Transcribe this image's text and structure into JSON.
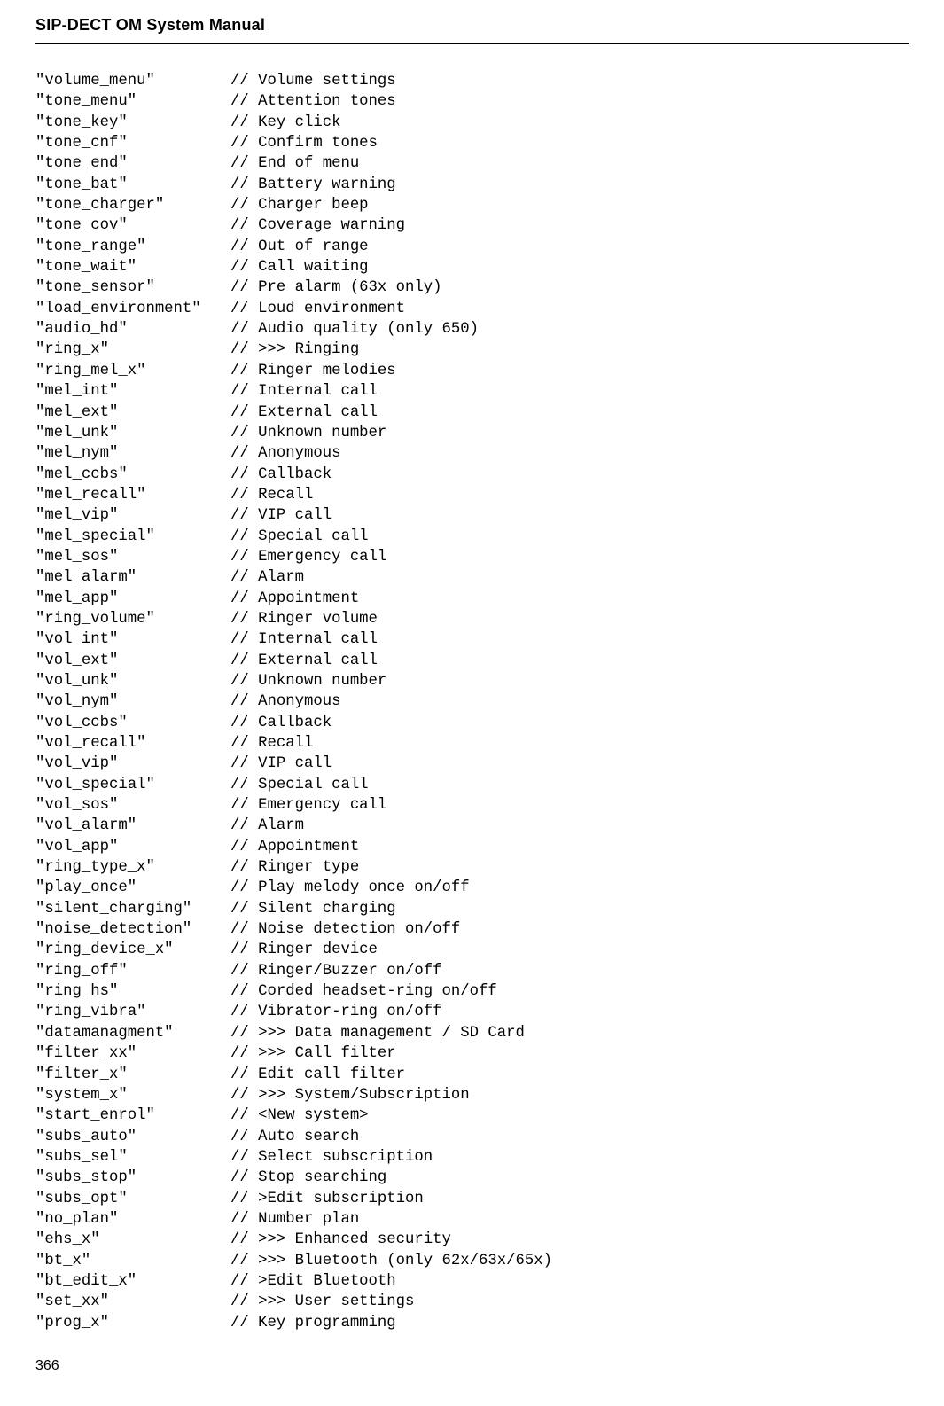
{
  "header": {
    "title": "SIP-DECT OM System Manual"
  },
  "page_number": "366",
  "code_rows": [
    {
      "key": "\"volume_menu\"",
      "comment": "// Volume settings"
    },
    {
      "key": "\"tone_menu\"",
      "comment": "// Attention tones"
    },
    {
      "key": "\"tone_key\"",
      "comment": "// Key click"
    },
    {
      "key": "\"tone_cnf\"",
      "comment": "// Confirm tones"
    },
    {
      "key": "\"tone_end\"",
      "comment": "// End of menu"
    },
    {
      "key": "\"tone_bat\"",
      "comment": "// Battery warning"
    },
    {
      "key": "\"tone_charger\"",
      "comment": "// Charger beep"
    },
    {
      "key": "\"tone_cov\"",
      "comment": "// Coverage warning"
    },
    {
      "key": "\"tone_range\"",
      "comment": "// Out of range"
    },
    {
      "key": "\"tone_wait\"",
      "comment": "// Call waiting"
    },
    {
      "key": "\"tone_sensor\"",
      "comment": "// Pre alarm (63x only)"
    },
    {
      "key": "\"load_environment\"",
      "comment": "// Loud environment"
    },
    {
      "key": "\"audio_hd\"",
      "comment": "// Audio quality (only 650)"
    },
    {
      "key": "\"ring_x\"",
      "comment": "// >>> Ringing"
    },
    {
      "key": "\"ring_mel_x\"",
      "comment": "// Ringer melodies"
    },
    {
      "key": "\"mel_int\"",
      "comment": "// Internal call"
    },
    {
      "key": "\"mel_ext\"",
      "comment": "// External call"
    },
    {
      "key": "\"mel_unk\"",
      "comment": "// Unknown number"
    },
    {
      "key": "\"mel_nym\"",
      "comment": "// Anonymous"
    },
    {
      "key": "\"mel_ccbs\"",
      "comment": "// Callback"
    },
    {
      "key": "\"mel_recall\"",
      "comment": "// Recall"
    },
    {
      "key": "\"mel_vip\"",
      "comment": "// VIP call"
    },
    {
      "key": "\"mel_special\"",
      "comment": "// Special call"
    },
    {
      "key": "\"mel_sos\"",
      "comment": "// Emergency call"
    },
    {
      "key": "\"mel_alarm\"",
      "comment": "// Alarm"
    },
    {
      "key": "\"mel_app\"",
      "comment": "// Appointment"
    },
    {
      "key": "\"ring_volume\"",
      "comment": "// Ringer volume"
    },
    {
      "key": "\"vol_int\"",
      "comment": "// Internal call"
    },
    {
      "key": "\"vol_ext\"",
      "comment": "// External call"
    },
    {
      "key": "\"vol_unk\"",
      "comment": "// Unknown number"
    },
    {
      "key": "\"vol_nym\"",
      "comment": "// Anonymous"
    },
    {
      "key": "\"vol_ccbs\"",
      "comment": "// Callback"
    },
    {
      "key": "\"vol_recall\"",
      "comment": "// Recall"
    },
    {
      "key": "\"vol_vip\"",
      "comment": "// VIP call"
    },
    {
      "key": "\"vol_special\"",
      "comment": "// Special call"
    },
    {
      "key": "\"vol_sos\"",
      "comment": "// Emergency call"
    },
    {
      "key": "\"vol_alarm\"",
      "comment": "// Alarm"
    },
    {
      "key": "\"vol_app\"",
      "comment": "// Appointment"
    },
    {
      "key": "\"ring_type_x\"",
      "comment": "// Ringer type"
    },
    {
      "key": "\"play_once\"",
      "comment": "// Play melody once on/off"
    },
    {
      "key": "\"silent_charging\"",
      "comment": "// Silent charging"
    },
    {
      "key": "\"noise_detection\"",
      "comment": "// Noise detection on/off"
    },
    {
      "key": "\"ring_device_x\"",
      "comment": "// Ringer device"
    },
    {
      "key": "\"ring_off\"",
      "comment": "// Ringer/Buzzer on/off"
    },
    {
      "key": "\"ring_hs\"",
      "comment": "// Corded headset-ring on/off"
    },
    {
      "key": "\"ring_vibra\"",
      "comment": "// Vibrator-ring on/off"
    },
    {
      "key": "\"datamanagment\"",
      "comment": "// >>> Data management / SD Card"
    },
    {
      "key": "\"filter_xx\"",
      "comment": "// >>> Call filter"
    },
    {
      "key": "\"filter_x\"",
      "comment": "// Edit call filter"
    },
    {
      "key": "\"system_x\"",
      "comment": "// >>> System/Subscription"
    },
    {
      "key": "\"start_enrol\"",
      "comment": "// <New system>"
    },
    {
      "key": "\"subs_auto\"",
      "comment": "// Auto search"
    },
    {
      "key": "\"subs_sel\"",
      "comment": "// Select subscription"
    },
    {
      "key": "\"subs_stop\"",
      "comment": "// Stop searching"
    },
    {
      "key": "\"subs_opt\"",
      "comment": "// >Edit subscription"
    },
    {
      "key": "\"no_plan\"",
      "comment": "// Number plan"
    },
    {
      "key": "\"ehs_x\"",
      "comment": "// >>> Enhanced security"
    },
    {
      "key": "\"bt_x\"",
      "comment": "// >>> Bluetooth (only 62x/63x/65x)"
    },
    {
      "key": "\"bt_edit_x\"",
      "comment": "// >Edit Bluetooth"
    },
    {
      "key": "\"set_xx\"",
      "comment": "// >>> User settings"
    },
    {
      "key": "\"prog_x\"",
      "comment": "// Key programming"
    }
  ]
}
